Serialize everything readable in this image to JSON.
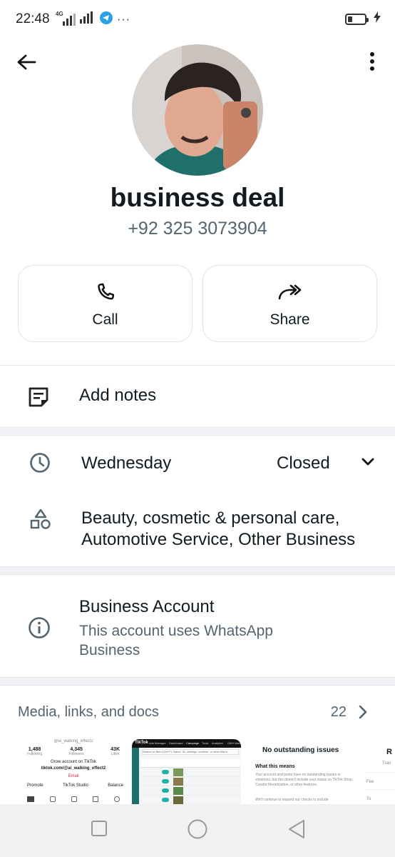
{
  "status_bar": {
    "time": "22:48",
    "network": "4G",
    "icons": [
      "signal-icon",
      "signal-icon",
      "telegram-icon",
      "more-notifications-icon",
      "battery-icon",
      "charging-icon"
    ],
    "battery_level": 0.25
  },
  "contact": {
    "name": "business deal",
    "phone": "+92 325 3073904"
  },
  "actions": [
    {
      "label": "Call",
      "icon": "phone-icon"
    },
    {
      "label": "Share",
      "icon": "share-icon"
    }
  ],
  "notes": {
    "label": "Add notes",
    "icon": "notes-icon"
  },
  "hours": {
    "day": "Wednesday",
    "status": "Closed",
    "icon": "clock-icon"
  },
  "category": {
    "line1": "Beauty, cosmetic & personal care,",
    "line2": "Automotive Service, Other Business",
    "icon": "category-icon"
  },
  "business_account": {
    "title": "Business Account",
    "subtitle_line1": "This account uses WhatsApp",
    "subtitle_line2": "Business",
    "icon": "info-icon"
  },
  "media": {
    "title": "Media, links, and docs",
    "count": "22",
    "thumbnails": [
      {
        "handle": "@ai_walking_effect2",
        "stats": [
          {
            "value": "1,488",
            "label": "Following"
          },
          {
            "value": "4,345",
            "label": "Followers"
          },
          {
            "value": "43K",
            "label": "Likes"
          }
        ],
        "bio": "Grow account on TikTok",
        "link": "tiktok.com/@ai_walking_effect2",
        "email": "Email",
        "buttons": [
          "Promote",
          "TikTok Studio",
          "Balance"
        ]
      },
      {
        "brand": "TikTok",
        "app": "Ads Manager",
        "tabs": [
          "Dashboard",
          "Campaign",
          "Tools",
          "Analytics",
          "GMV Max"
        ],
        "search": "Search or filter (Ctrl+F): Name, ID, settings, creative, or other filters"
      },
      {
        "heading": "No outstanding issues",
        "subheading": "What this means",
        "body": "Your account and posts have no outstanding issues or violations, but this doesn't include your status on TikTok Shop, Creator Monetization, or other features.",
        "body2": "We'll continue to expand our checks to include"
      },
      {
        "letter": "R",
        "sub": "Tran",
        "rows": [
          "Fee",
          "To"
        ]
      }
    ]
  },
  "nav_bar": [
    "recents-icon",
    "home-icon",
    "back-nav-icon"
  ]
}
